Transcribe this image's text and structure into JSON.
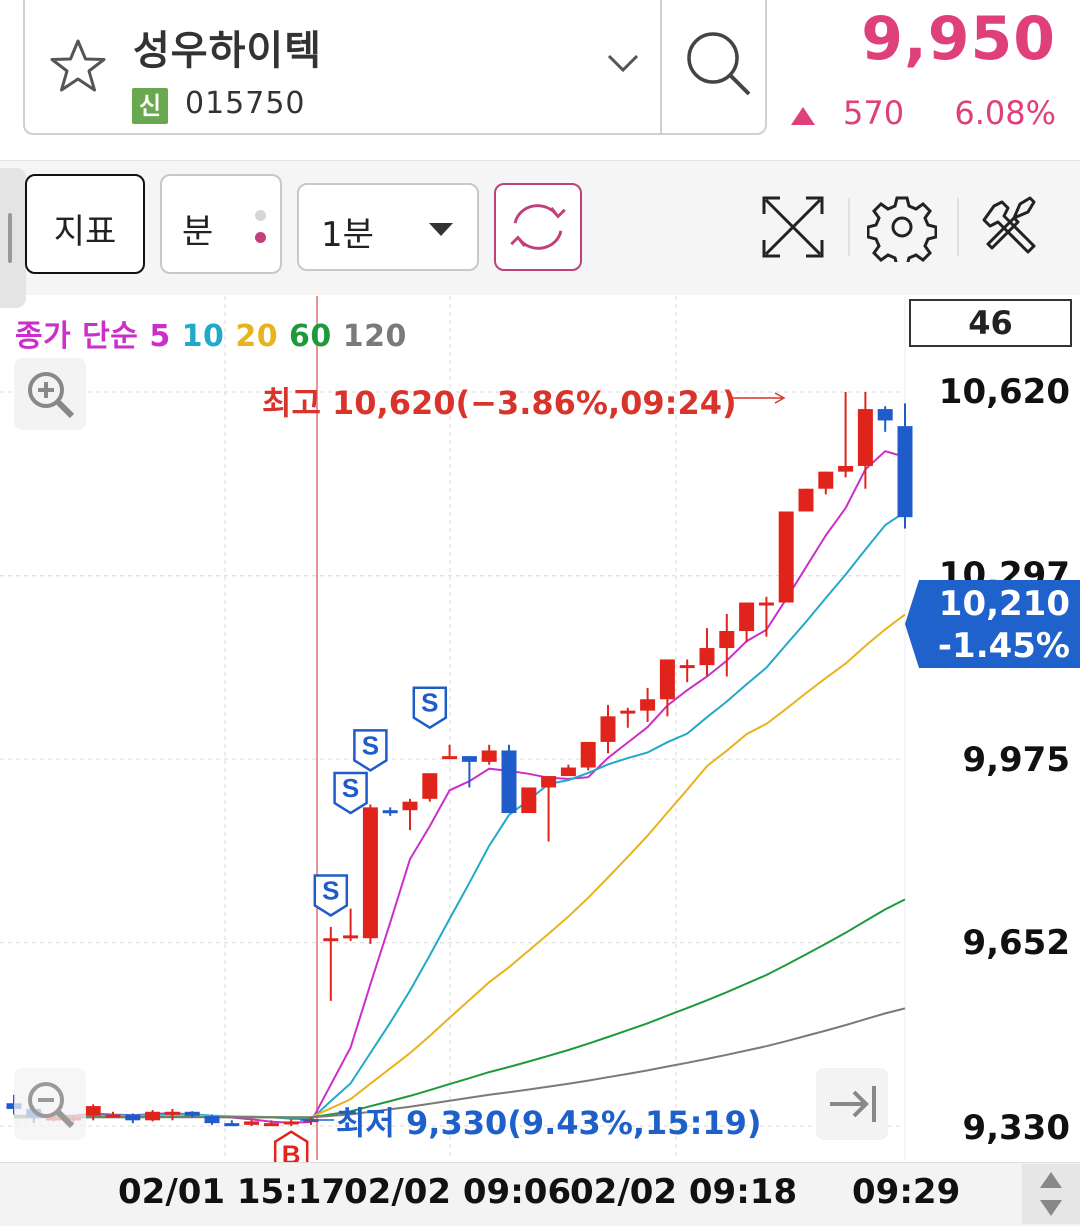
{
  "header": {
    "stock_name": "성우하이텍",
    "badge": "신",
    "stock_code": "015750",
    "price": "9,950",
    "change_value": "570",
    "change_percent": "6.08%",
    "change_direction": "up"
  },
  "toolbar": {
    "indicator_label": "지표",
    "minute_label": "분",
    "period_label": "1분",
    "icons": [
      "fullscreen-icon",
      "settings-icon",
      "tools-icon"
    ]
  },
  "chart_top": {
    "legend": {
      "prefix": "종가 단순",
      "periods": [
        "5",
        "10",
        "20",
        "60",
        "120"
      ],
      "colors": [
        "#cc2fc9",
        "#21a9c9",
        "#e8b31c",
        "#1e9a3c",
        "#7a7a7a"
      ]
    },
    "count": "46"
  },
  "chart_data": {
    "type": "candlestick",
    "y_ticks": [
      "10,620",
      "10,297",
      "9,975",
      "9,652",
      "9,330"
    ],
    "ylim": [
      9330,
      10620
    ],
    "x_labels": [
      "02/01 15:17",
      "02/02 09:06",
      "02/02 09:18",
      "09:29"
    ],
    "current": {
      "price": "10,210",
      "change": "-1.45%"
    },
    "high_annotation": "최고 10,620(−3.86%,09:24)",
    "low_annotation": "최저 9,330(9.43%,15:19)",
    "candles": [
      [
        9370,
        9385,
        9350,
        9360
      ],
      [
        9360,
        9365,
        9335,
        9345
      ],
      [
        9345,
        9352,
        9338,
        9345
      ],
      [
        9345,
        9350,
        9335,
        9345
      ],
      [
        9348,
        9368,
        9340,
        9365
      ],
      [
        9350,
        9355,
        9345,
        9350
      ],
      [
        9350,
        9352,
        9335,
        9340
      ],
      [
        9340,
        9358,
        9338,
        9355
      ],
      [
        9352,
        9360,
        9340,
        9355
      ],
      [
        9355,
        9356,
        9345,
        9348
      ],
      [
        9348,
        9350,
        9332,
        9335
      ],
      [
        9335,
        9340,
        9330,
        9332
      ],
      [
        9332,
        9340,
        9330,
        9338
      ],
      [
        9334,
        9340,
        9330,
        9335
      ],
      [
        9335,
        9342,
        9330,
        9338
      ],
      [
        9338,
        9345,
        9332,
        9342
      ],
      [
        9660,
        9680,
        9550,
        9660
      ],
      [
        9660,
        9712,
        9655,
        9665
      ],
      [
        9660,
        9895,
        9650,
        9890
      ],
      [
        9885,
        9890,
        9875,
        9880
      ],
      [
        9885,
        9905,
        9850,
        9900
      ],
      [
        9905,
        9950,
        9900,
        9950
      ],
      [
        9975,
        10000,
        9980,
        9980
      ],
      [
        9980,
        9980,
        9925,
        9970
      ],
      [
        9970,
        10000,
        9965,
        9990
      ],
      [
        9990,
        10000,
        9880,
        9880
      ],
      [
        9880,
        9925,
        9880,
        9925
      ],
      [
        9925,
        9945,
        9830,
        9945
      ],
      [
        9945,
        9965,
        9945,
        9960
      ],
      [
        9960,
        10005,
        9955,
        10005
      ],
      [
        10005,
        10070,
        9985,
        10050
      ],
      [
        10060,
        10065,
        10030,
        10060
      ],
      [
        10060,
        10100,
        10040,
        10080
      ],
      [
        10080,
        10150,
        10050,
        10150
      ],
      [
        10140,
        10150,
        10110,
        10140
      ],
      [
        10140,
        10205,
        10120,
        10170
      ],
      [
        10170,
        10230,
        10120,
        10200
      ],
      [
        10200,
        10240,
        10180,
        10250
      ],
      [
        10250,
        10260,
        10190,
        10250
      ],
      [
        10250,
        10410,
        10250,
        10410
      ],
      [
        10410,
        10450,
        10420,
        10450
      ],
      [
        10450,
        10480,
        10440,
        10480
      ],
      [
        10480,
        10620,
        10470,
        10490
      ],
      [
        10490,
        10620,
        10450,
        10590
      ],
      [
        10590,
        10595,
        10550,
        10570
      ],
      [
        10560,
        10600,
        10380,
        10400
      ]
    ]
  }
}
